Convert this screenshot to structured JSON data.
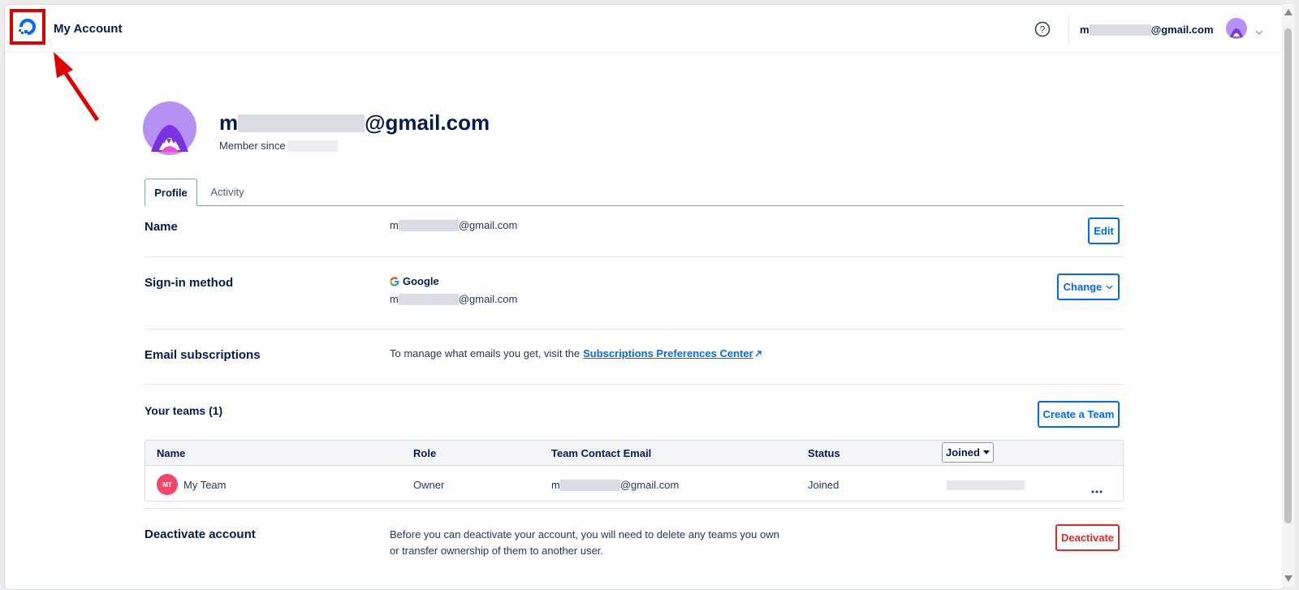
{
  "header": {
    "title": "My Account",
    "email_prefix": "m",
    "email_suffix": "@gmail.com",
    "logo_icon": "digitalocean-logo-icon",
    "help_icon": "help-circle-icon"
  },
  "profile": {
    "email_prefix": "m",
    "email_suffix": "@gmail.com",
    "member_since_label": "Member since"
  },
  "tabs": [
    {
      "label": "Profile",
      "active": true
    },
    {
      "label": "Activity",
      "active": false
    }
  ],
  "sections": {
    "name": {
      "label": "Name",
      "value_prefix": "m",
      "value_suffix": "@gmail.com",
      "button": "Edit"
    },
    "signin": {
      "label": "Sign-in method",
      "provider": "Google",
      "value_prefix": "m",
      "value_suffix": "@gmail.com",
      "button": "Change"
    },
    "email_subs": {
      "label": "Email subscriptions",
      "text": "To manage what emails you get, visit the",
      "link": "Subscriptions Preferences Center"
    },
    "teams": {
      "label": "Your teams (1)",
      "button": "Create a Team",
      "columns": [
        "Name",
        "Role",
        "Team Contact Email",
        "Status"
      ],
      "sort_select": "Joined",
      "rows": [
        {
          "initials": "MT",
          "name": "My Team",
          "role": "Owner",
          "email_prefix": "m",
          "email_suffix": "@gmail.com",
          "status": "Joined"
        }
      ]
    },
    "deactivate": {
      "label": "Deactivate account",
      "text_line1": "Before you can deactivate your account, you will need to delete any teams you own",
      "text_line2": "or transfer ownership of them to another user.",
      "button": "Deactivate"
    }
  },
  "colors": {
    "brand": "#0069ff",
    "danger": "#e02b2b",
    "highlight": "#e00000",
    "text": "#031b4e"
  }
}
